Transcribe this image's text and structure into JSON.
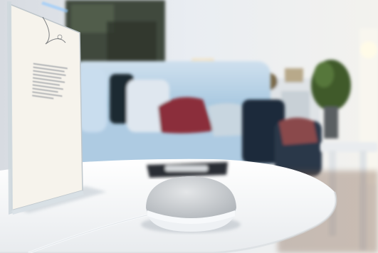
{
  "scene": {
    "description_free": true,
    "colors": {
      "sky_wall": "#e9edf2",
      "sofa": "#b9d2e6",
      "pillow_red": "#8b2f3a",
      "table_top": "#f5f7f9",
      "speaker_fabric": "#d3d6d9",
      "speaker_base": "#eef1f4",
      "window_glow": "#fffbe8"
    },
    "objects": [
      {
        "name": "smart-speaker",
        "icon": "speaker"
      },
      {
        "name": "tv-remote",
        "icon": "remote"
      },
      {
        "name": "info-sign",
        "icon": "sign"
      },
      {
        "name": "floor-lamp",
        "icon": "lamp"
      },
      {
        "name": "potted-plant",
        "icon": "plant"
      }
    ],
    "sign": {
      "title": "",
      "logo": ""
    }
  }
}
